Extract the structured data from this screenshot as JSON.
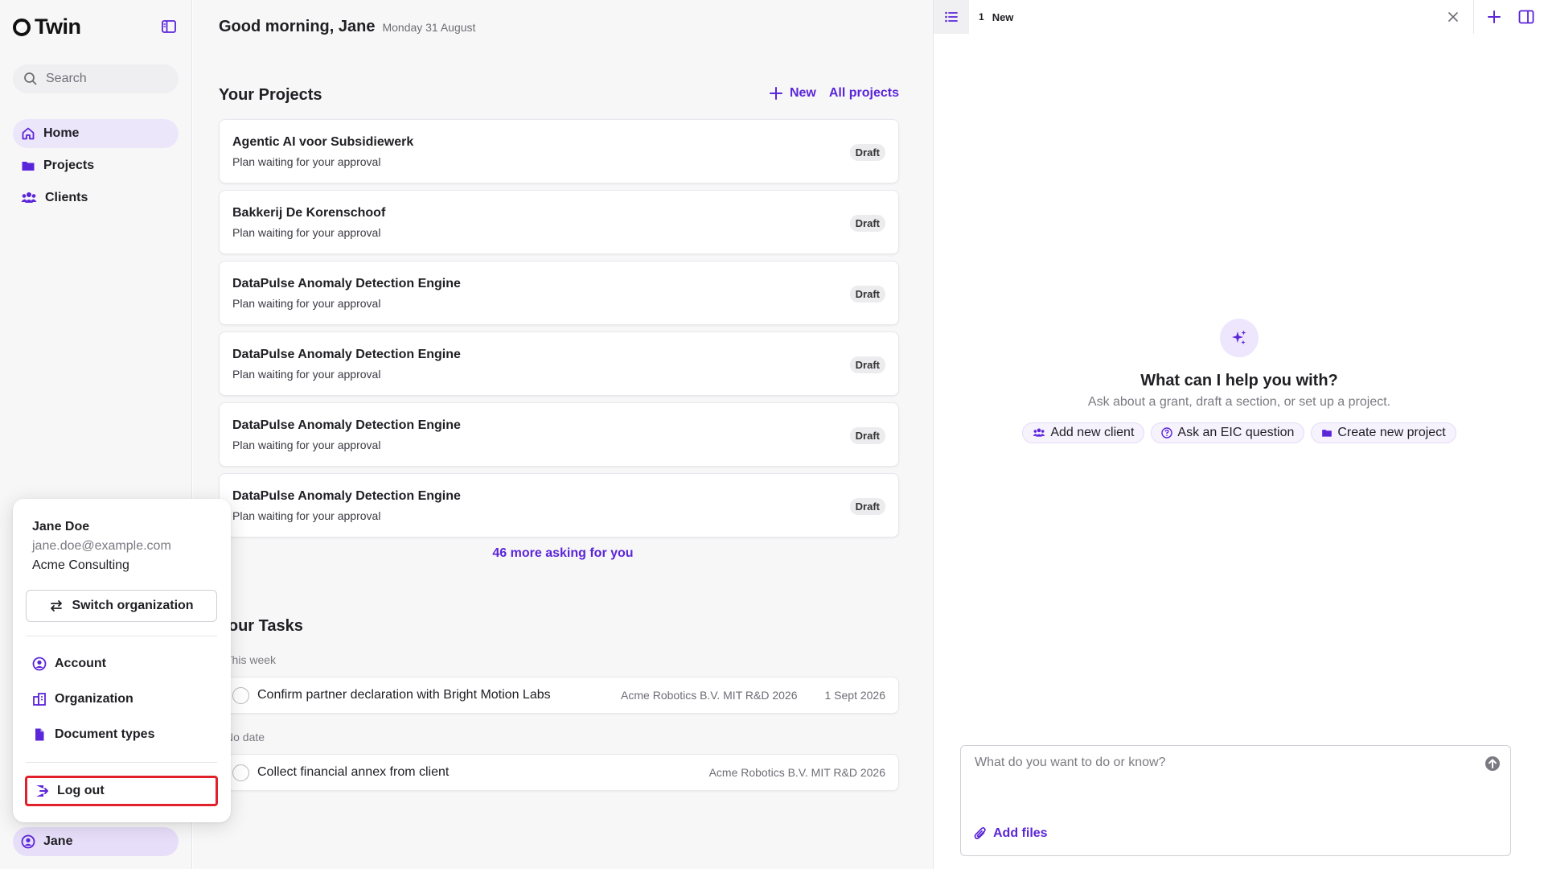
{
  "app": {
    "name": "Twin"
  },
  "sidebar": {
    "search_placeholder": "Search",
    "nav": [
      {
        "label": "Home",
        "icon": "home-icon",
        "active": true
      },
      {
        "label": "Projects",
        "icon": "folder-icon"
      },
      {
        "label": "Clients",
        "icon": "users-icon"
      }
    ],
    "user_pill": "Jane"
  },
  "account_menu": {
    "name": "Jane Doe",
    "email": "jane.doe@example.com",
    "organization": "Acme Consulting",
    "switch_label": "Switch organization",
    "items": [
      {
        "label": "Account",
        "icon": "user-circle-icon"
      },
      {
        "label": "Organization",
        "icon": "building-icon"
      },
      {
        "label": "Document types",
        "icon": "document-icon"
      }
    ],
    "logout_label": "Log out"
  },
  "main": {
    "greeting": "Good morning, Jane",
    "date": "Monday 31 August",
    "projects": {
      "title": "Your Projects",
      "new_label": "New",
      "all_label": "All projects",
      "items": [
        {
          "title": "Agentic AI voor Subsidiewerk",
          "subtitle": "Plan waiting for your approval",
          "badge": "Draft"
        },
        {
          "title": "Bakkerij De Korenschoof",
          "subtitle": "Plan waiting for your approval",
          "badge": "Draft"
        },
        {
          "title": "DataPulse Anomaly Detection Engine",
          "subtitle": "Plan waiting for your approval",
          "badge": "Draft"
        },
        {
          "title": "DataPulse Anomaly Detection Engine",
          "subtitle": "Plan waiting for your approval",
          "badge": "Draft"
        },
        {
          "title": "DataPulse Anomaly Detection Engine",
          "subtitle": "Plan waiting for your approval",
          "badge": "Draft"
        },
        {
          "title": "DataPulse Anomaly Detection Engine",
          "subtitle": "Plan waiting for your approval",
          "badge": "Draft"
        }
      ],
      "more_label": "46 more asking for you"
    },
    "tasks": {
      "title": "Your Tasks",
      "groups": [
        {
          "label": "This week",
          "items": [
            {
              "text": "Confirm partner declaration with Bright Motion Labs",
              "project": "Acme Robotics B.V. MIT R&D 2026",
              "date": "1 Sept 2026"
            }
          ]
        },
        {
          "label": "No date",
          "items": [
            {
              "text": "Collect financial annex from client",
              "project": "Acme Robotics B.V. MIT R&D 2026",
              "date": ""
            }
          ]
        }
      ]
    }
  },
  "panel": {
    "tab": {
      "number": "1",
      "label": "New"
    },
    "hero": {
      "title": "What can I help you with?",
      "subtitle": "Ask about a grant, draft a section, or set up a project."
    },
    "chips": [
      {
        "label": "Add new client",
        "icon": "users-icon"
      },
      {
        "label": "Ask an EIC question",
        "icon": "question-circle-icon"
      },
      {
        "label": "Create new project",
        "icon": "folder-icon"
      }
    ],
    "composer": {
      "placeholder": "What do you want to do or know?",
      "add_files_label": "Add files"
    }
  },
  "colors": {
    "accent": "#5b25d9",
    "active_nav_bg": "#ece6fb",
    "highlight_border": "#e0202b"
  }
}
